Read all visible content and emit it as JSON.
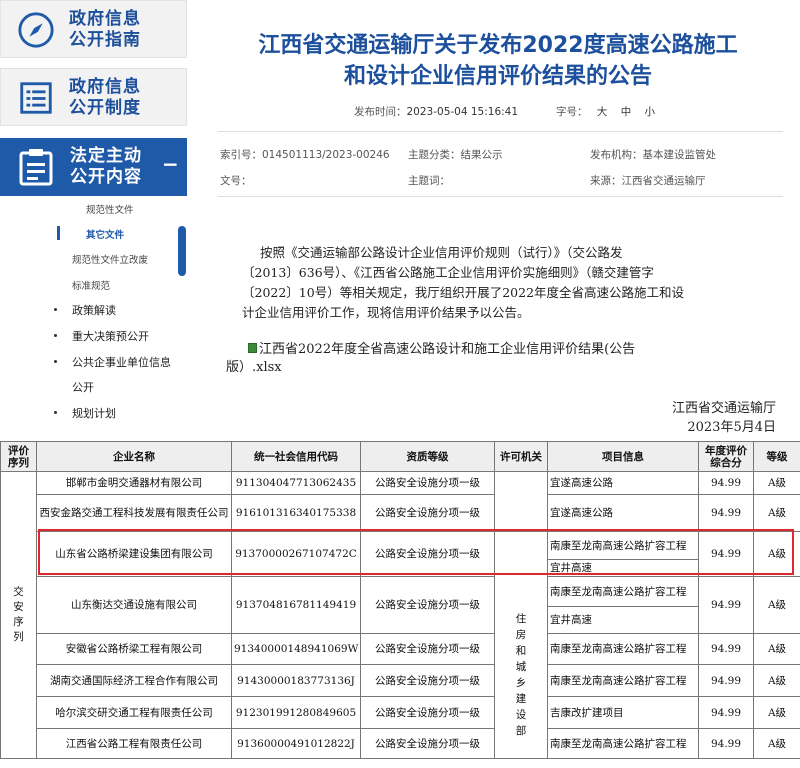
{
  "nav": {
    "guide": [
      "政府信息",
      "公开指南"
    ],
    "system": [
      "政府信息",
      "公开制度"
    ],
    "active": [
      "法定主动",
      "公开内容"
    ],
    "active_toggle": "−",
    "sub_items": [
      "规范性文件",
      "其它文件",
      "规范性文件立改废",
      "标准规范"
    ],
    "bullets": [
      "政策解读",
      "重大决策预公开",
      "公共企事业单位信息",
      "公开",
      "规划计划"
    ]
  },
  "article": {
    "title_line1": "江西省交通运输厅关于发布2022度高速公路施工",
    "title_line2": "和设计企业信用评价结果的公告",
    "publish_label": "发布时间：",
    "publish_time": "2023-05-04 15:16:41",
    "fontsize_label": "字号：",
    "font_large": "大",
    "font_medium": "中",
    "font_small": "小",
    "index_label": "索引号：",
    "index_value": "014501113/2023-00246",
    "category_label": "主题分类：",
    "category_value": "结果公示",
    "org_label": "发布机构：",
    "org_value": "基本建设监管处",
    "docno_label": "文号：",
    "docno_value": "",
    "subject_label": "主题词：",
    "subject_value": "",
    "source_label": "来源：",
    "source_value": "江西省交通运输厅",
    "para_line1": "按照《交通运输部公路设计企业信用评价规则（试行）》（交公路发",
    "para_line2": "〔2013〕636号）、《江西省公路施工企业信用评价实施细则》（赣交建管字",
    "para_line3": "〔2022〕10号）等相关规定，我厅组织开展了2022年度全省高速公路施工和设",
    "para_line4": "计企业信用评价工作，现将信用评价结果予以公告。",
    "attachment_line1": "江西省2022年度全省高速公路设计和施工企业信用评价结果(公告",
    "attachment_line2": "版）.xlsx",
    "sign_org": "江西省交通运输厅",
    "sign_date": "2023年5月4日"
  },
  "table": {
    "headers": [
      "评价序列",
      "企业名称",
      "统一社会信用代码",
      "资质等级",
      "许可机关",
      "项目信息",
      "年度评价综合分",
      "等级"
    ],
    "header_col0": [
      "评价",
      "序列"
    ],
    "header_score": [
      "年度评价",
      "综合分"
    ],
    "series_label": [
      "交",
      "安",
      "序",
      "列"
    ],
    "authority_label": [
      "住",
      "房",
      "和",
      "城",
      "乡",
      "建",
      "设",
      "部"
    ],
    "rows": [
      {
        "name": "邯郸市金明交通器材有限公司",
        "code": "911304047713062435",
        "qual": "公路安全设施分项一级",
        "projects": [
          "宜遂高速公路"
        ],
        "score": "94.99",
        "grade": "A级"
      },
      {
        "name": "西安金路交通工程科技发展有限责任公司",
        "code": "916101316340175338",
        "qual": "公路安全设施分项一级",
        "projects": [
          "宜遂高速公路"
        ],
        "score": "94.99",
        "grade": "A级"
      },
      {
        "name": "山东省公路桥梁建设集团有限公司",
        "code": "91370000267107472C",
        "qual": "公路安全设施分项一级",
        "projects": [
          "南康至龙南高速公路扩容工程",
          "宜井高速"
        ],
        "score": "94.99",
        "grade": "A级"
      },
      {
        "name": "山东衡达交通设施有限公司",
        "code": "913704816781149419",
        "qual": "公路安全设施分项一级",
        "projects": [
          "南康至龙南高速公路扩容工程",
          "宜井高速"
        ],
        "score": "94.99",
        "grade": "A级"
      },
      {
        "name": "安徽省公路桥梁工程有限公司",
        "code": "91340000148941069W",
        "qual": "公路安全设施分项一级",
        "projects": [
          "南康至龙南高速公路扩容工程"
        ],
        "score": "94.99",
        "grade": "A级"
      },
      {
        "name": "湖南交通国际经济工程合作有限公司",
        "code": "91430000183773136J",
        "qual": "公路安全设施分项一级",
        "projects": [
          "南康至龙南高速公路扩容工程"
        ],
        "score": "94.99",
        "grade": "A级"
      },
      {
        "name": "哈尔滨交研交通工程有限责任公司",
        "code": "912301991280849605",
        "qual": "公路安全设施分项一级",
        "projects": [
          "吉康改扩建项目"
        ],
        "score": "94.99",
        "grade": "A级"
      },
      {
        "name": "江西省公路工程有限责任公司",
        "code": "91360000491012822J",
        "qual": "公路安全设施分项一级",
        "projects": [
          "南康至龙南高速公路扩容工程"
        ],
        "score": "94.99",
        "grade": "A级"
      }
    ]
  },
  "colors": {
    "brand": "#1f5aa8",
    "highlight": "#e02828"
  }
}
